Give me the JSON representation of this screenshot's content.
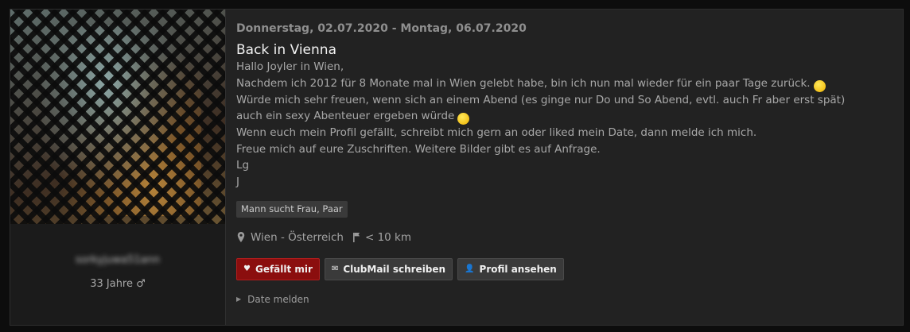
{
  "date_range": "Donnerstag, 02.07.2020 - Montag, 06.07.2020",
  "title": "Back in Vienna",
  "body_lines": [
    "Hallo Joyler in Wien,",
    "Nachdem ich 2012 für 8 Monate mal in Wien gelebt habe, bin ich nun mal wieder für ein paar Tage zurück.",
    "Würde mich sehr freuen, wenn sich an einem Abend (es ginge nur Do und So Abend, evtl. auch Fr aber erst spät)",
    "auch ein sexy Abenteuer ergeben würde",
    "Wenn euch mein Profil gefällt, schreibt mich gern an oder liked mein Date, dann melde ich mich.",
    "Freue mich auf eure Zuschriften. Weitere Bilder gibt es auf Anfrage.",
    "Lg",
    "J"
  ],
  "emoticons": {
    "line2": "smile-emoticon",
    "line4": "wink-emoticon"
  },
  "tag": "Mann sucht Frau, Paar",
  "location": "Wien - Österreich",
  "distance": "< 10 km",
  "profile": {
    "username": "sorkyjuwa51ann",
    "age": "33 Jahre ♂"
  },
  "buttons": {
    "like": "Gefällt mir",
    "clubmail": "ClubMail schreiben",
    "profile": "Profil ansehen"
  },
  "report_label": "Date melden",
  "colors": {
    "like_button": "#8b0e0e",
    "background": "#222222"
  }
}
